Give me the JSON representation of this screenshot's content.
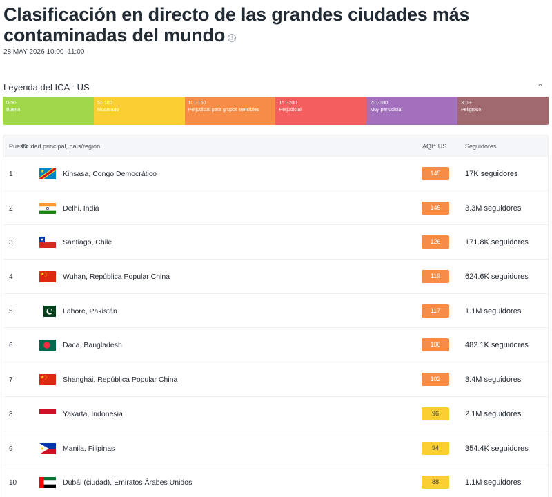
{
  "header": {
    "title": "Clasificación en directo de las grandes ciudades más contaminadas del mundo",
    "info_icon": "ⓘ",
    "timestamp": "28 MAY 2026 10:00–11:00"
  },
  "legend": {
    "title": "Leyenda del ICA⁺ US",
    "toggle_icon": "chevron-up-icon",
    "toggle_glyph": "⌃",
    "segments": [
      {
        "range": "0-50",
        "label": "Bueno",
        "color": "#a0d84a"
      },
      {
        "range": "51-100",
        "label": "Moderado",
        "color": "#f9cf31"
      },
      {
        "range": "101-150",
        "label": "Perjudicial para grupos sensibles",
        "color": "#f78c46"
      },
      {
        "range": "151-200",
        "label": "Perjudicial",
        "color": "#f55e5e"
      },
      {
        "range": "201-300",
        "label": "Muy perjudicial",
        "color": "#a270bd"
      },
      {
        "range": "301+",
        "label": "Peligroso",
        "color": "#a0686f"
      }
    ]
  },
  "table": {
    "headers": {
      "rank": "Puesto",
      "city": "Ciudad principal, país/región",
      "aqi": "AQI⁺ US",
      "followers": "Seguidores"
    },
    "rows": [
      {
        "rank": "1",
        "city": "Kinsasa, Congo Democrático",
        "aqi": "145",
        "followers": "17K seguidores",
        "flag": "cd",
        "level_color": "#f78c46"
      },
      {
        "rank": "2",
        "city": "Delhi, India",
        "aqi": "145",
        "followers": "3.3M seguidores",
        "flag": "in",
        "level_color": "#f78c46"
      },
      {
        "rank": "3",
        "city": "Santiago, Chile",
        "aqi": "126",
        "followers": "171.8K seguidores",
        "flag": "cl",
        "level_color": "#f78c46"
      },
      {
        "rank": "4",
        "city": "Wuhan, República Popular China",
        "aqi": "119",
        "followers": "624.6K seguidores",
        "flag": "cn",
        "level_color": "#f78c46"
      },
      {
        "rank": "5",
        "city": "Lahore, Pakistán",
        "aqi": "117",
        "followers": "1.1M seguidores",
        "flag": "pk",
        "level_color": "#f78c46"
      },
      {
        "rank": "6",
        "city": "Daca, Bangladesh",
        "aqi": "106",
        "followers": "482.1K seguidores",
        "flag": "bd",
        "level_color": "#f78c46"
      },
      {
        "rank": "7",
        "city": "Shanghái, República Popular China",
        "aqi": "102",
        "followers": "3.4M seguidores",
        "flag": "cn",
        "level_color": "#f78c46"
      },
      {
        "rank": "8",
        "city": "Yakarta, Indonesia",
        "aqi": "96",
        "followers": "2.1M seguidores",
        "flag": "id",
        "level_color": "#f9cf31"
      },
      {
        "rank": "9",
        "city": "Manila, Filipinas",
        "aqi": "94",
        "followers": "354.4K seguidores",
        "flag": "ph",
        "level_color": "#f9cf31"
      },
      {
        "rank": "10",
        "city": "Dubái (ciudad), Emiratos Árabes Unidos",
        "aqi": "88",
        "followers": "1.1M seguidores",
        "flag": "ae",
        "level_color": "#f9cf31"
      }
    ]
  }
}
